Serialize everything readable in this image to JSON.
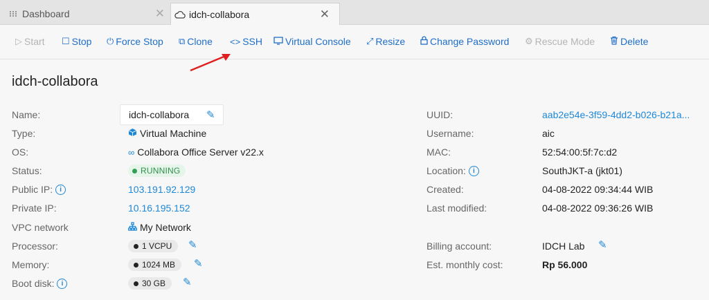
{
  "tabs": [
    {
      "label": "Dashboard"
    },
    {
      "label": "idch-collabora"
    }
  ],
  "toolbar": {
    "start": "Start",
    "stop": "Stop",
    "force_stop": "Force Stop",
    "clone": "Clone",
    "ssh": "SSH",
    "virtual_console": "Virtual Console",
    "resize": "Resize",
    "change_password": "Change Password",
    "rescue_mode": "Rescue Mode",
    "delete": "Delete"
  },
  "vm": {
    "title": "idch-collabora",
    "left": {
      "name_label": "Name:",
      "name_value": "idch-collabora",
      "type_label": "Type:",
      "type_value": "Virtual Machine",
      "os_label": "OS:",
      "os_value": "Collabora Office Server v22.x",
      "status_label": "Status:",
      "status_value": "RUNNING",
      "public_ip_label": "Public IP:",
      "public_ip_value": "103.191.92.129",
      "private_ip_label": "Private IP:",
      "private_ip_value": "10.16.195.152",
      "vpc_label": "VPC network",
      "vpc_value": "My Network",
      "processor_label": "Processor:",
      "processor_value": "1 VCPU",
      "memory_label": "Memory:",
      "memory_value": "1024 MB",
      "boot_label": "Boot disk:",
      "boot_value": "30 GB"
    },
    "right": {
      "uuid_label": "UUID:",
      "uuid_value": "aab2e54e-3f59-4dd2-b026-b21a...",
      "username_label": "Username:",
      "username_value": "aic",
      "mac_label": "MAC:",
      "mac_value": "52:54:00:5f:7c:d2",
      "location_label": "Location:",
      "location_value": "SouthJKT-a (jkt01)",
      "created_label": "Created:",
      "created_value": "04-08-2022 09:34:44 WIB",
      "modified_label": "Last modified:",
      "modified_value": "04-08-2022 09:36:26 WIB",
      "billing_label": "Billing account:",
      "billing_value": "IDCH Lab",
      "cost_label": "Est. monthly cost:",
      "cost_value": "Rp 56.000"
    }
  },
  "colors": {
    "accent": "#1e6ec8",
    "link": "#1e88d8",
    "running": "#2f9f55",
    "annotation_arrow": "#e02020"
  }
}
